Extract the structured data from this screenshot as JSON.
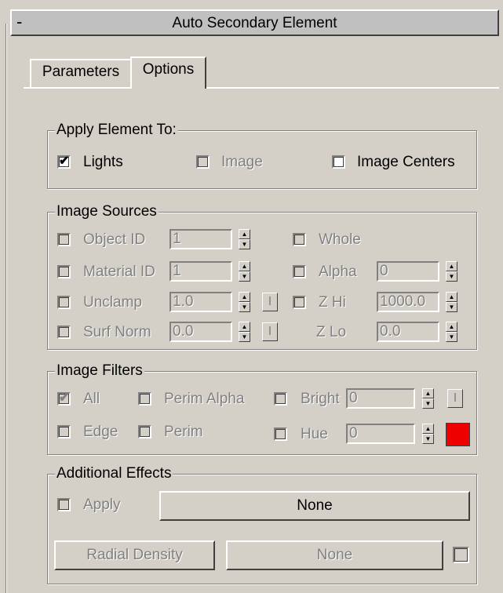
{
  "rollout": {
    "toggle": "-",
    "title": "Auto Secondary Element"
  },
  "tabs": {
    "parameters": "Parameters",
    "options": "Options"
  },
  "apply_element_to": {
    "title": "Apply Element To:",
    "lights": {
      "label": "Lights",
      "checked": true,
      "enabled": true
    },
    "image": {
      "label": "Image",
      "checked": false,
      "enabled": false
    },
    "image_centers": {
      "label": "Image Centers",
      "checked": false,
      "enabled": true
    }
  },
  "image_sources": {
    "title": "Image Sources",
    "object_id": {
      "label": "Object ID",
      "value": "1"
    },
    "material_id": {
      "label": "Material ID",
      "value": "1"
    },
    "unclamp": {
      "label": "Unclamp",
      "value": "1.0",
      "button": "I"
    },
    "surf_norm": {
      "label": "Surf Norm",
      "value": "0.0",
      "button": "I"
    },
    "whole": {
      "label": "Whole"
    },
    "alpha": {
      "label": "Alpha",
      "value": "0"
    },
    "z_hi": {
      "label": "Z Hi",
      "value": "1000.0"
    },
    "z_lo": {
      "label": "Z Lo",
      "value": "0.0"
    }
  },
  "image_filters": {
    "title": "Image Filters",
    "all": {
      "label": "All",
      "checked": true
    },
    "edge": {
      "label": "Edge"
    },
    "perim_alpha": {
      "label": "Perim Alpha"
    },
    "perim": {
      "label": "Perim"
    },
    "bright": {
      "label": "Bright",
      "value": "0",
      "button": "I"
    },
    "hue": {
      "label": "Hue",
      "value": "0",
      "color": "#ee0000"
    }
  },
  "additional_effects": {
    "title": "Additional Effects",
    "apply": {
      "label": "Apply"
    },
    "map_button": "None",
    "radial_density_button": "Radial Density",
    "radial_map_button": "None"
  }
}
